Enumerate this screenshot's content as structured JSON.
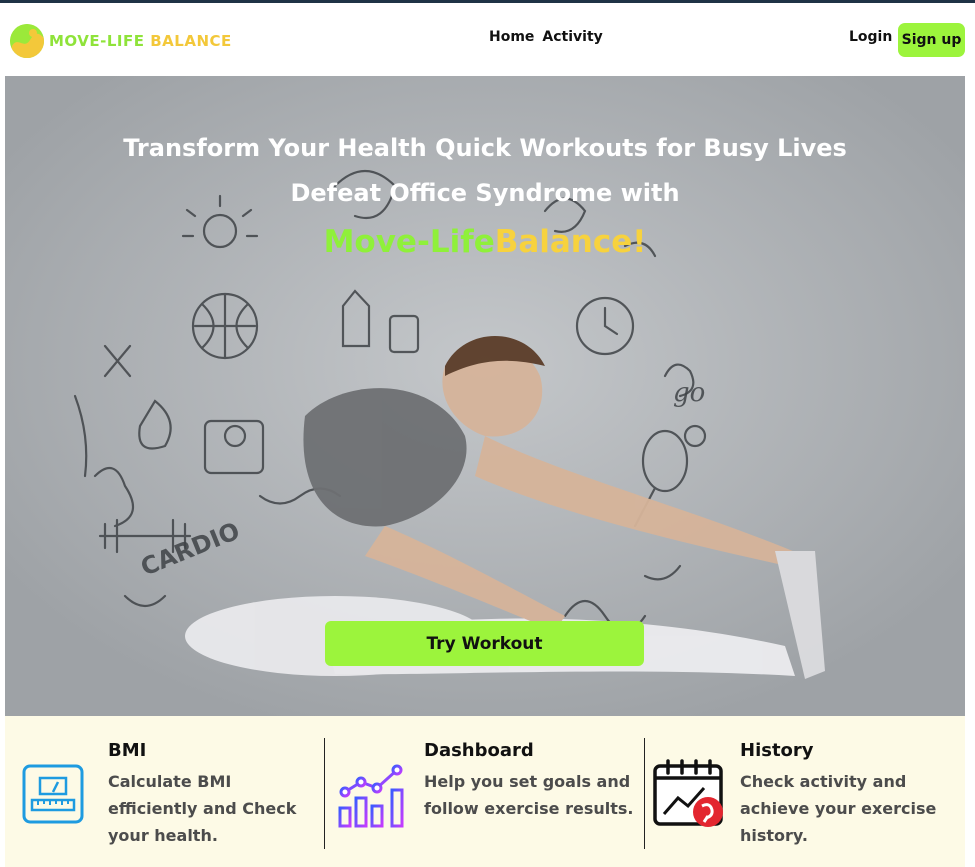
{
  "brand": {
    "name_part1": "MOVE-LIFE",
    "name_part2": "BALANCE"
  },
  "nav": {
    "items": [
      {
        "label": "Home"
      },
      {
        "label": "Activity"
      }
    ]
  },
  "auth": {
    "login_label": "Login",
    "signup_label": "Sign up"
  },
  "hero": {
    "line1": "Transform Your Health Quick Workouts for Busy Lives",
    "line2": "Defeat Office Syndrome with",
    "brand_part1": "Move-Life",
    "brand_part2": "Balance!",
    "cta_label": "Try Workout"
  },
  "features": [
    {
      "title": "BMI",
      "description": "Calculate BMI efficiently and Check your health.",
      "icon": "scale-icon"
    },
    {
      "title": "Dashboard",
      "description": "Help you set goals and follow exercise results.",
      "icon": "chart-icon"
    },
    {
      "title": "History",
      "description": "Check activity and achieve your exercise history.",
      "icon": "calendar-history-icon"
    }
  ],
  "colors": {
    "accent_green": "#9cf43c",
    "accent_yellow": "#f3c83a",
    "feature_bg": "#fdfae6",
    "topline": "#1f3346"
  }
}
